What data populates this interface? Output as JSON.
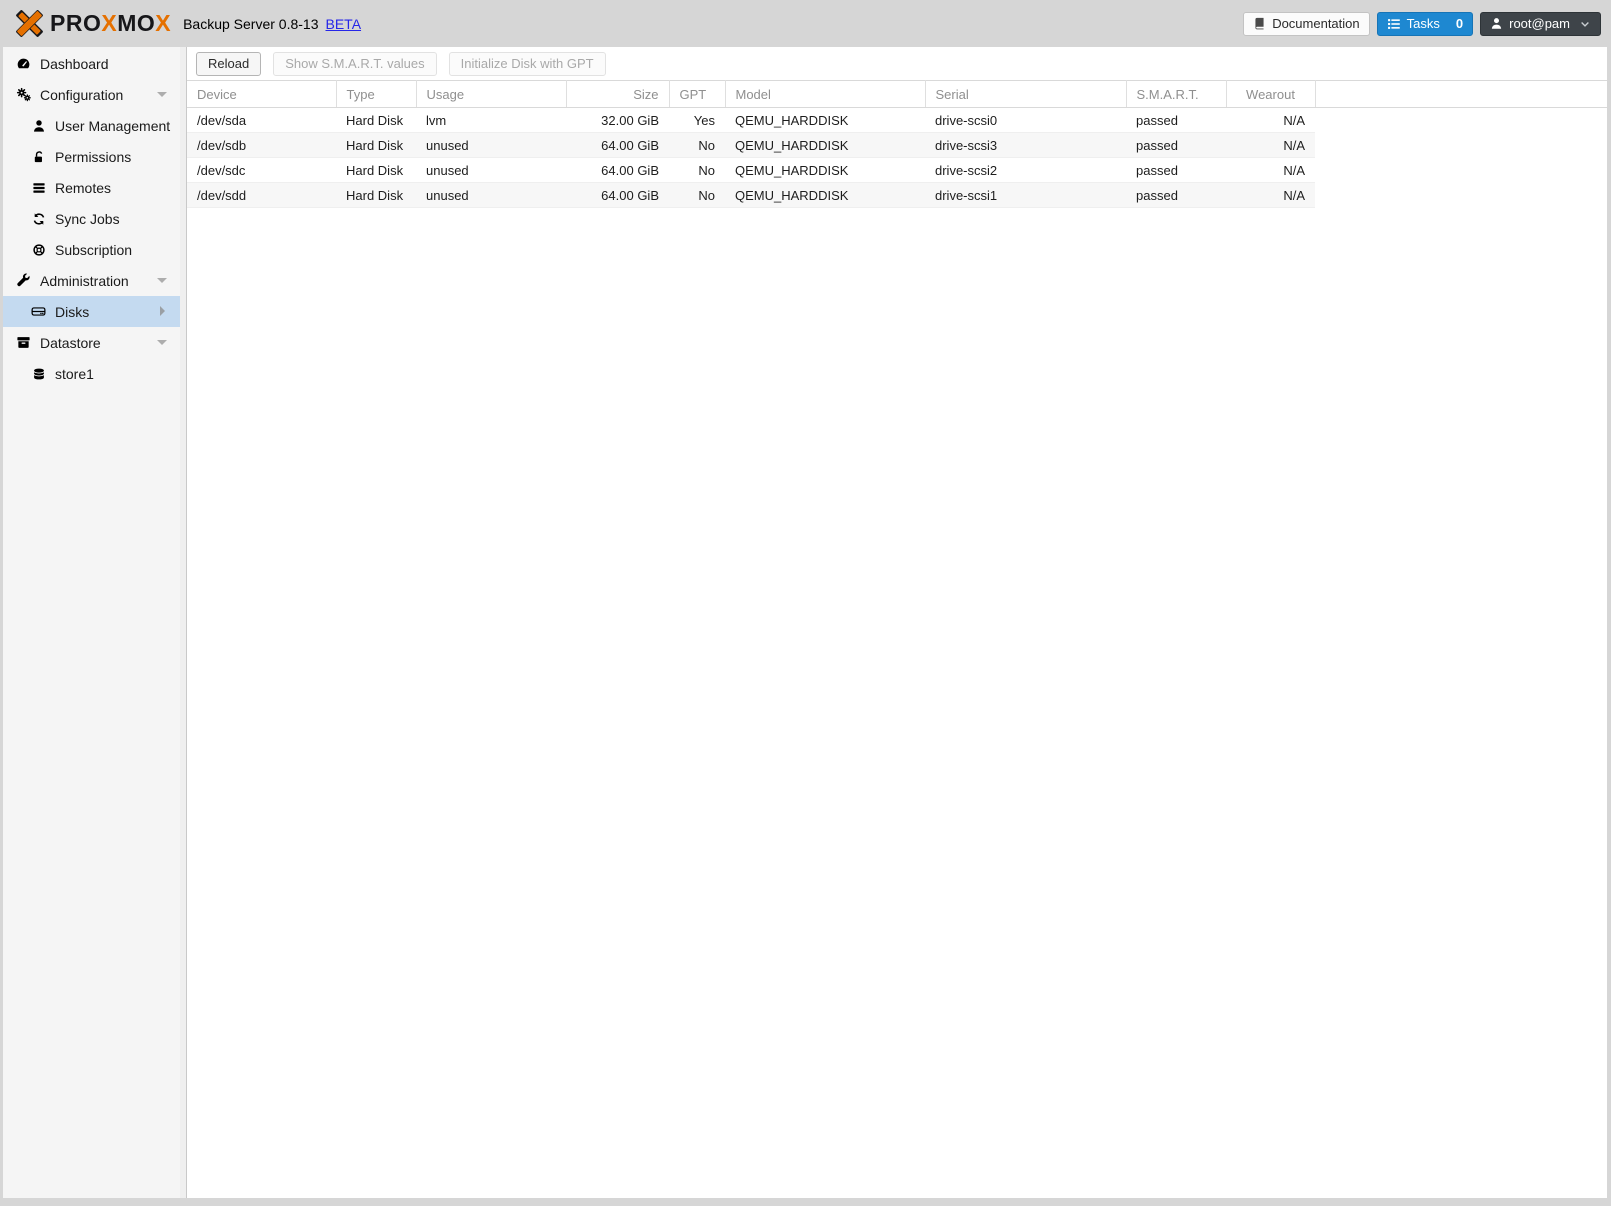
{
  "app": {
    "logo_segments": [
      {
        "text": "PRO"
      },
      {
        "text": "X"
      },
      {
        "text": "MO"
      },
      {
        "text": "X"
      }
    ],
    "title": "Backup Server 0.8-13",
    "beta_label": "BETA"
  },
  "header_buttons": {
    "documentation_label": "Documentation",
    "tasks_label": "Tasks",
    "tasks_count": "0",
    "user_label": "root@pam"
  },
  "sidebar": {
    "items": [
      {
        "label": "Dashboard",
        "icon": "dashboard-icon",
        "level": 0,
        "caret": "none",
        "selected": false
      },
      {
        "label": "Configuration",
        "icon": "gears-icon",
        "level": 0,
        "caret": "down",
        "selected": false
      },
      {
        "label": "User Management",
        "icon": "user-icon",
        "level": 1,
        "caret": "none",
        "selected": false
      },
      {
        "label": "Permissions",
        "icon": "unlock-icon",
        "level": 1,
        "caret": "none",
        "selected": false
      },
      {
        "label": "Remotes",
        "icon": "server-icon",
        "level": 1,
        "caret": "none",
        "selected": false
      },
      {
        "label": "Sync Jobs",
        "icon": "refresh-icon",
        "level": 1,
        "caret": "none",
        "selected": false
      },
      {
        "label": "Subscription",
        "icon": "support-icon",
        "level": 1,
        "caret": "none",
        "selected": false
      },
      {
        "label": "Administration",
        "icon": "wrench-icon",
        "level": 0,
        "caret": "down",
        "selected": false
      },
      {
        "label": "Disks",
        "icon": "hdd-icon",
        "level": 1,
        "caret": "right",
        "selected": true
      },
      {
        "label": "Datastore",
        "icon": "archive-icon",
        "level": 0,
        "caret": "down",
        "selected": false
      },
      {
        "label": "store1",
        "icon": "database-icon",
        "level": 1,
        "caret": "none",
        "selected": false
      }
    ]
  },
  "toolbar": {
    "reload_label": "Reload",
    "smart_label": "Show S.M.A.R.T. values",
    "gpt_label": "Initialize Disk with GPT"
  },
  "table": {
    "columns": [
      {
        "label": "Device"
      },
      {
        "label": "Type"
      },
      {
        "label": "Usage"
      },
      {
        "label": "Size"
      },
      {
        "label": "GPT"
      },
      {
        "label": "Model"
      },
      {
        "label": "Serial"
      },
      {
        "label": "S.M.A.R.T."
      },
      {
        "label": "Wearout"
      }
    ],
    "rows": [
      {
        "device": "/dev/sda",
        "type": "Hard Disk",
        "usage": "lvm",
        "size": "32.00 GiB",
        "gpt": "Yes",
        "model": "QEMU_HARDDISK",
        "serial": "drive-scsi0",
        "smart": "passed",
        "wearout": "N/A"
      },
      {
        "device": "/dev/sdb",
        "type": "Hard Disk",
        "usage": "unused",
        "size": "64.00 GiB",
        "gpt": "No",
        "model": "QEMU_HARDDISK",
        "serial": "drive-scsi3",
        "smart": "passed",
        "wearout": "N/A"
      },
      {
        "device": "/dev/sdc",
        "type": "Hard Disk",
        "usage": "unused",
        "size": "64.00 GiB",
        "gpt": "No",
        "model": "QEMU_HARDDISK",
        "serial": "drive-scsi2",
        "smart": "passed",
        "wearout": "N/A"
      },
      {
        "device": "/dev/sdd",
        "type": "Hard Disk",
        "usage": "unused",
        "size": "64.00 GiB",
        "gpt": "No",
        "model": "QEMU_HARDDISK",
        "serial": "drive-scsi1",
        "smart": "passed",
        "wearout": "N/A"
      }
    ]
  },
  "colors": {
    "accent_orange": "#e57000",
    "accent_blue": "#1e88d1",
    "user_button_dark": "#3e4449",
    "selected_item_bg": "#c4daf0",
    "frame_gray": "#d6d6d6"
  }
}
